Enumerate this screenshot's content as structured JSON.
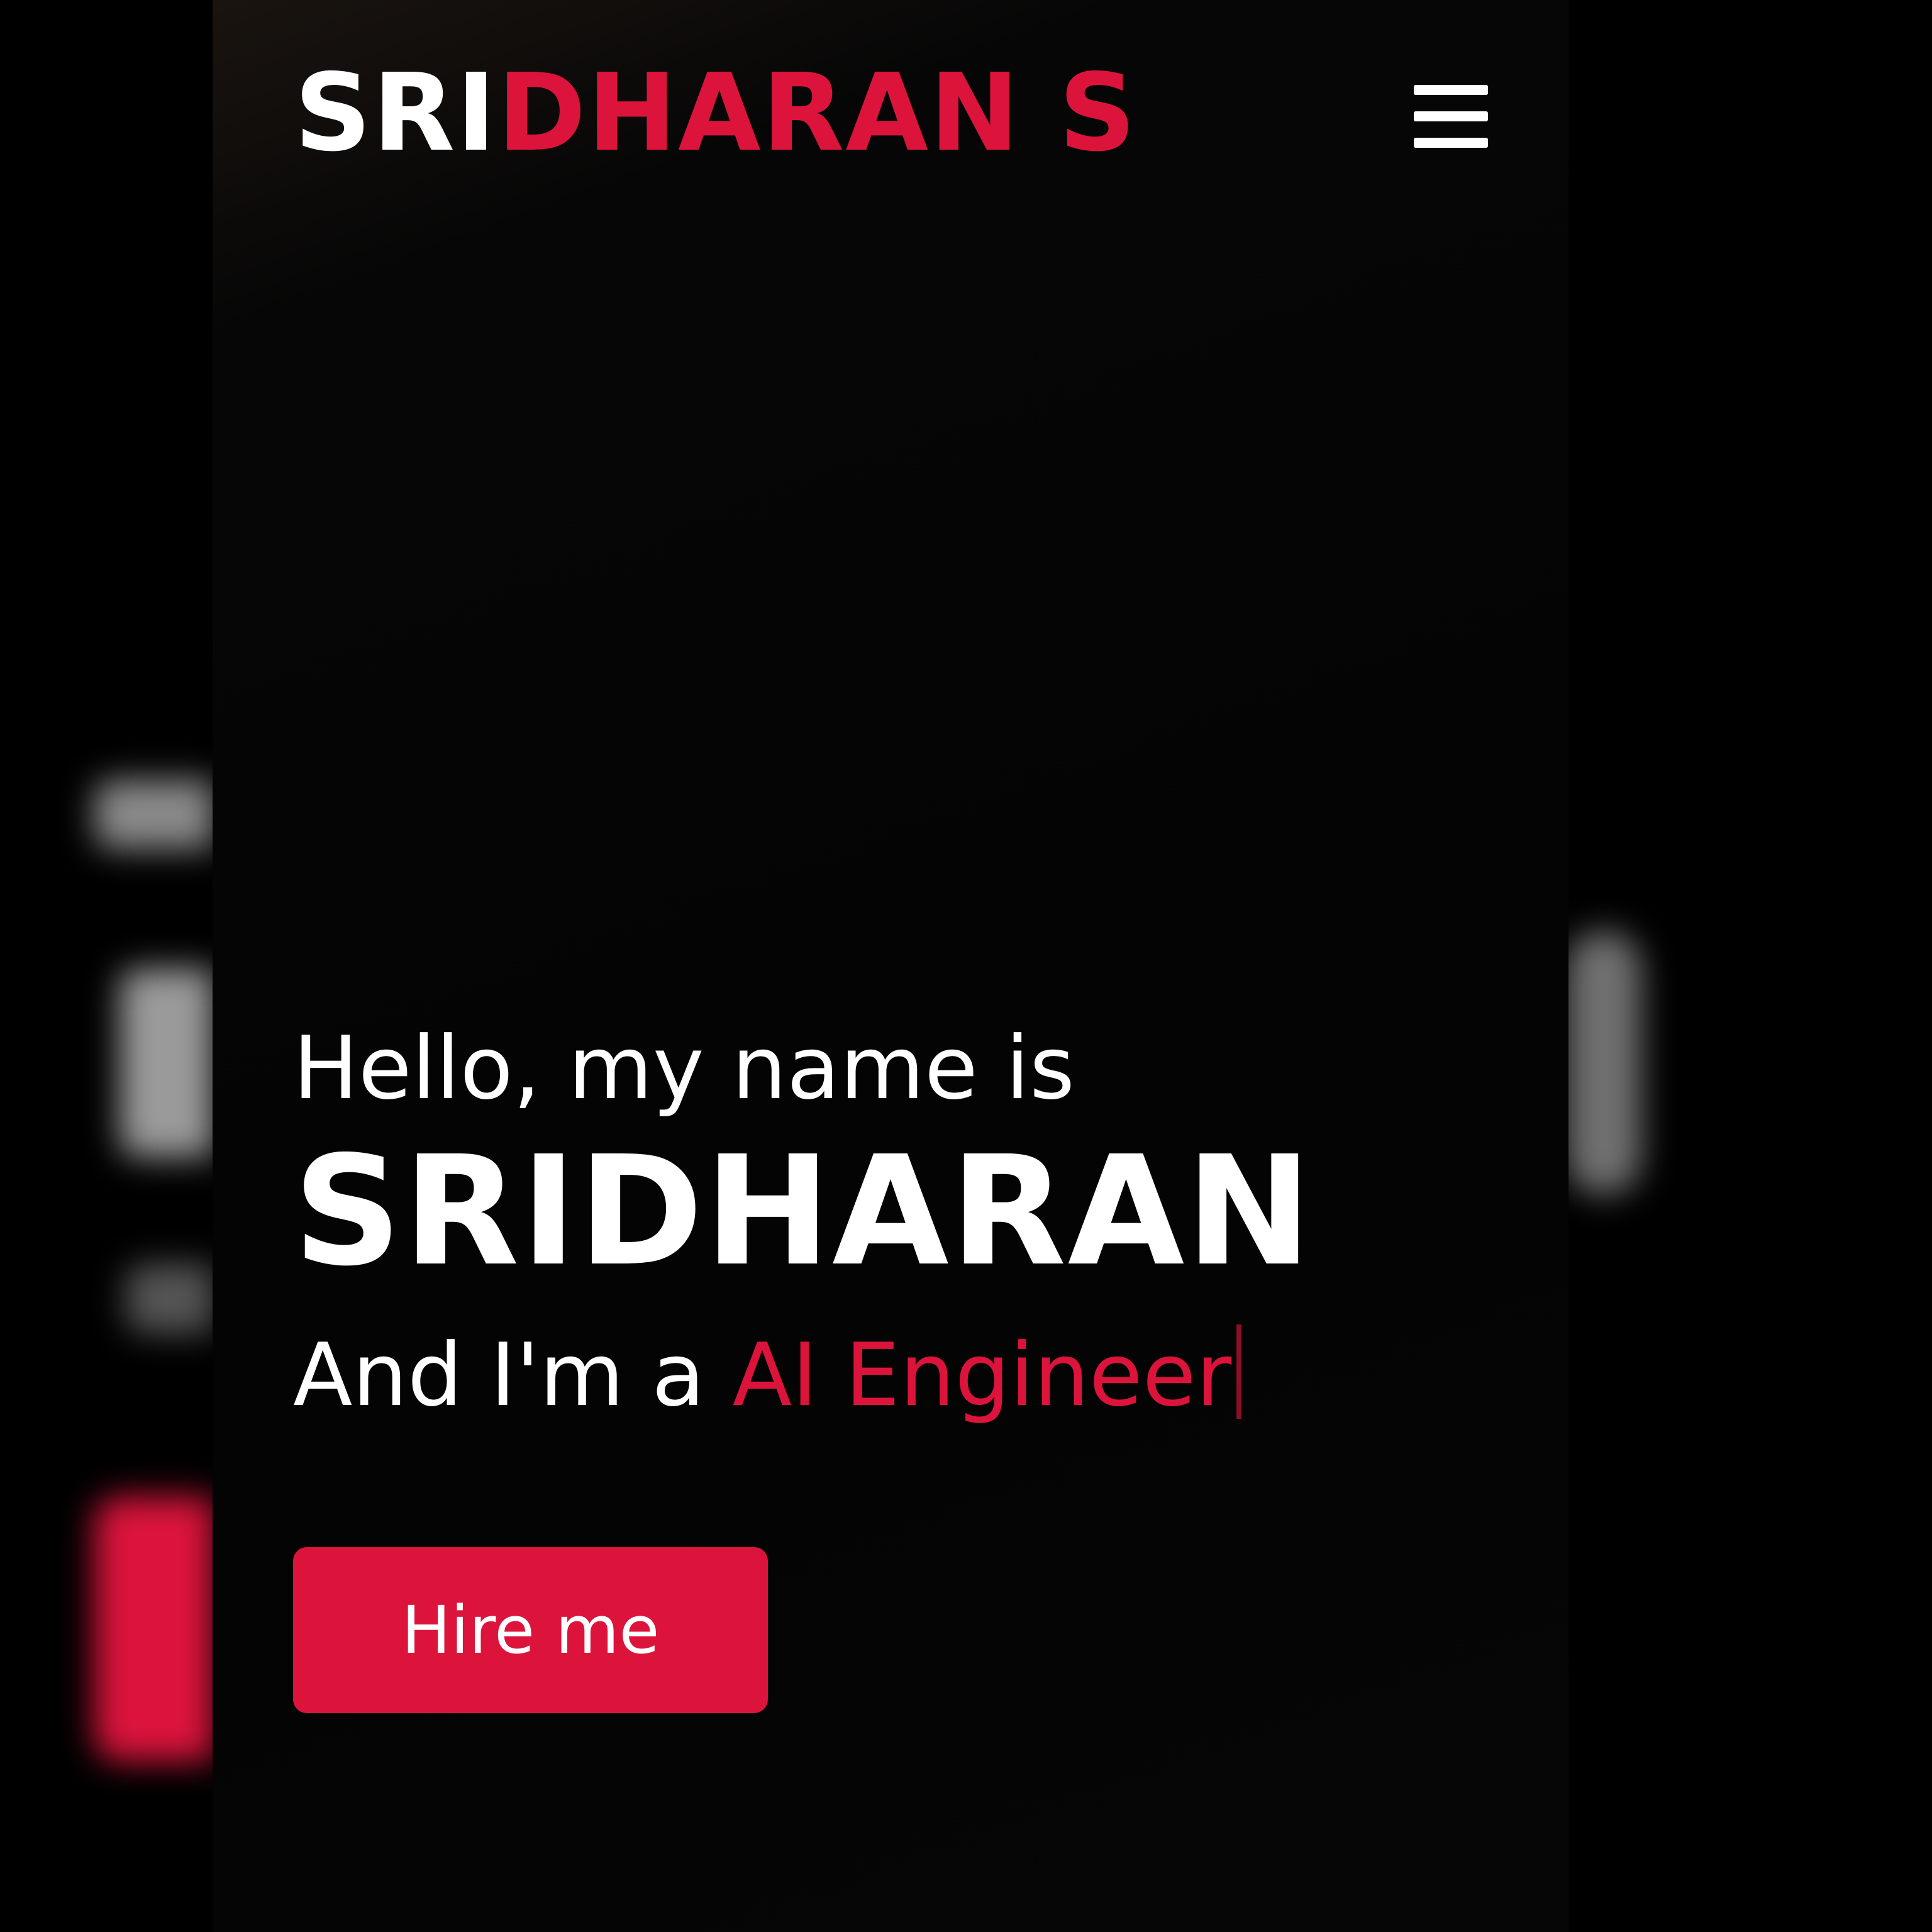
{
  "header": {
    "logo_part_white": "SRI",
    "logo_part_red": "DHARAN S",
    "menu_icon": "hamburger-menu-icon"
  },
  "hero": {
    "greeting": "Hello, my name is",
    "name": "SRIDHARAN",
    "role_prefix": "And I'm a ",
    "role": "AI Engineer",
    "button_label": "Hire me"
  },
  "colors": {
    "background": "#000000",
    "accent": "#dc143c",
    "text": "#ffffff"
  }
}
